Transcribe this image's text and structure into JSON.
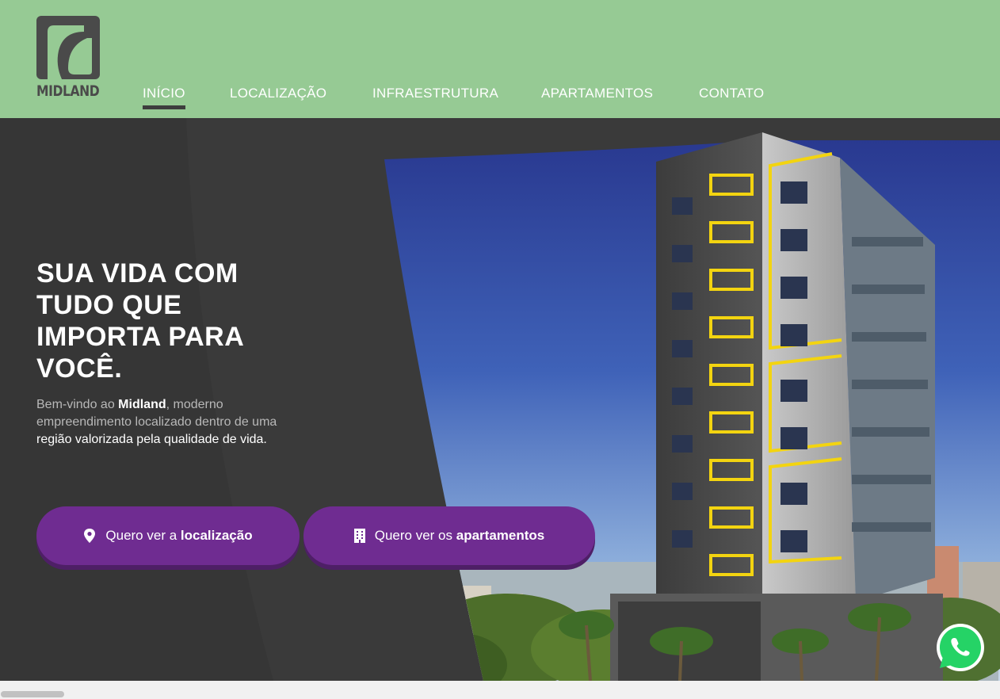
{
  "brand": {
    "logo_text": "MIDLAND",
    "icon": "midland-leaf-logo"
  },
  "nav": {
    "items": [
      {
        "label": "INÍCIO",
        "active": true
      },
      {
        "label": "LOCALIZAÇÃO",
        "active": false
      },
      {
        "label": "INFRAESTRUTURA",
        "active": false
      },
      {
        "label": "APARTAMENTOS",
        "active": false
      },
      {
        "label": "CONTATO",
        "active": false
      }
    ]
  },
  "hero": {
    "title_lines": [
      "SUA VIDA COM",
      "TUDO QUE",
      "IMPORTA PARA",
      "VOCÊ."
    ],
    "intro": {
      "part1": "Bem-vindo ao ",
      "brand": "Midland",
      "part2": ", moderno empreendimento localizado dentro de uma ",
      "highlight": "região valorizada pela qualidade de vida."
    },
    "buttons": {
      "location": {
        "prefix": "Quero ver a ",
        "bold": "localização",
        "icon": "map-pin-icon"
      },
      "apartments": {
        "prefix": "Quero ver os ",
        "bold": "apartamentos",
        "icon": "building-icon"
      }
    }
  },
  "floating": {
    "icon": "whatsapp-icon"
  },
  "colors": {
    "header_bg": "#96ca94",
    "hero_bg": "#3a3a3a",
    "button": "#6f2c91",
    "button_shadow": "#4e1f66",
    "accent_yellow": "#f3d410",
    "whatsapp": "#25d366"
  }
}
